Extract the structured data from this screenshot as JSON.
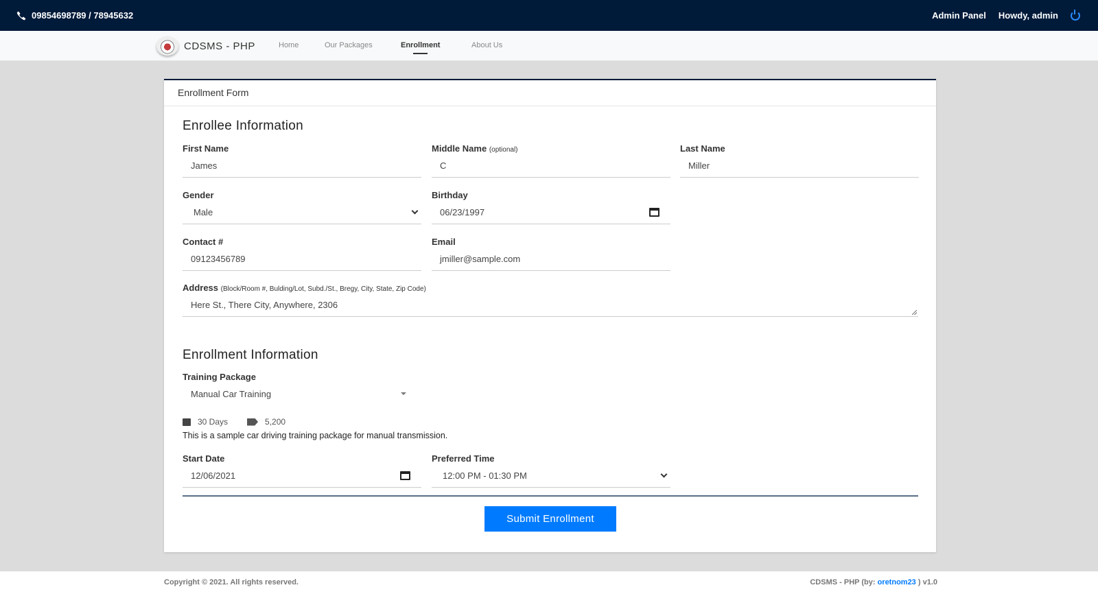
{
  "topbar": {
    "phone": "09854698789 / 78945632",
    "admin_panel": "Admin Panel",
    "greeting": "Howdy, admin"
  },
  "navbar": {
    "brand": "CDSMS - PHP",
    "links": [
      "Home",
      "Our Packages",
      "Enrollment",
      "About Us"
    ]
  },
  "card": {
    "header": "Enrollment Form",
    "enrollee_title": "Enrollee Information",
    "first_name": {
      "label": "First Name",
      "value": "James"
    },
    "middle_name": {
      "label": "Middle Name",
      "hint": "(optional)",
      "value": "C"
    },
    "last_name": {
      "label": "Last Name",
      "value": "Miller"
    },
    "gender": {
      "label": "Gender",
      "value": "Male"
    },
    "birthday": {
      "label": "Birthday",
      "value": "06/23/1997"
    },
    "contact": {
      "label": "Contact #",
      "value": "09123456789"
    },
    "email": {
      "label": "Email",
      "value": "jmiller@sample.com"
    },
    "address": {
      "label": "Address",
      "hint": "(Block/Room #, Bulding/Lot, Subd./St., Bregy, City, State, Zip Code)",
      "value": "Here St., There City, Anywhere, 2306"
    },
    "enrollment_title": "Enrollment Information",
    "package": {
      "label": "Training Package",
      "value": "Manual Car Training"
    },
    "package_days": "30 Days",
    "package_price": "5,200",
    "package_desc": "This is a sample car driving training package for manual transmission.",
    "start_date": {
      "label": "Start Date",
      "value": "12/06/2021"
    },
    "preferred_time": {
      "label": "Preferred Time",
      "value": "12:00 PM - 01:30 PM"
    },
    "submit": "Submit Enrollment"
  },
  "footer": {
    "copyright": "Copyright © 2021. All rights reserved.",
    "credit_prefix": "CDSMS - PHP (by: ",
    "credit_author": "oretnom23",
    "credit_suffix": " ) v1.0"
  }
}
